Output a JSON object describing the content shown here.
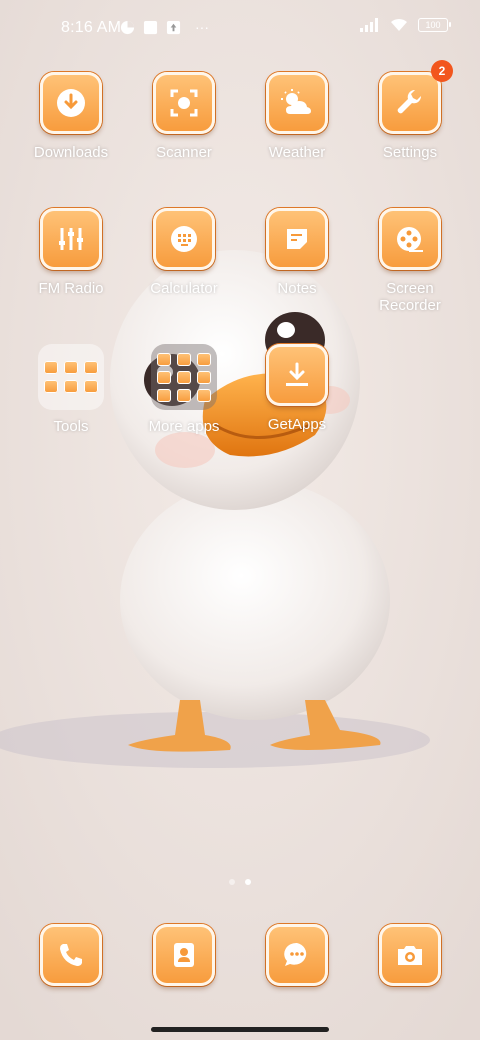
{
  "status_bar": {
    "time": "8:16 AM",
    "more_indicator": "···",
    "battery": "100"
  },
  "apps": {
    "downloads": "Downloads",
    "scanner": "Scanner",
    "weather": "Weather",
    "settings": "Settings",
    "settings_badge": "2",
    "fm_radio": "FM Radio",
    "calculator": "Calculator",
    "notes": "Notes",
    "screen_recorder": "Screen Recorder",
    "tools": "Tools",
    "more_apps": "More apps",
    "getapps": "GetApps"
  },
  "dock": {
    "phone": "phone-icon",
    "contacts": "contacts-icon",
    "messages": "messages-icon",
    "camera": "camera-icon"
  },
  "pager": {
    "pages": 2,
    "current": 2
  },
  "colors": {
    "icon_orange": "#f79a3a",
    "badge": "#f2561d"
  }
}
